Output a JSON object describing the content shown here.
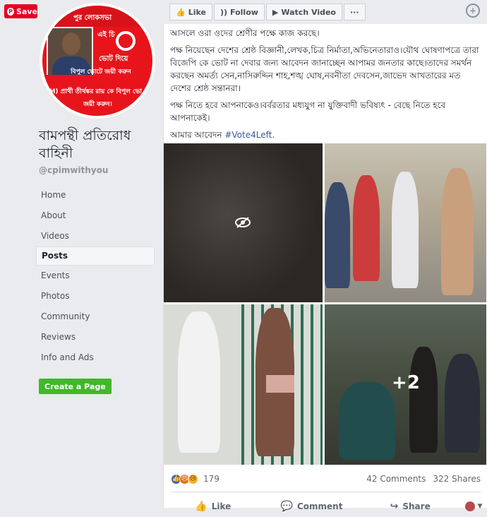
{
  "save_button": {
    "label": "Save"
  },
  "profile": {
    "name": "বামপন্থী প্রতিরোধ বাহিনী",
    "handle": "@cpimwithyou",
    "pic_text_top": "পুর লোকসভা",
    "pic_text_mid": "এই   চি",
    "pic_text_vote": "ভোট   দিয়ে",
    "pic_text_bipul": "বিপুল ভোটে জয়ী করুন",
    "pic_text_bottom1": "I(M) প্রার্থী তীর্থঙ্কর রায় কে বিপুল ভো",
    "pic_text_bottom2": "জয়ী করুন।"
  },
  "nav": {
    "items": [
      {
        "label": "Home"
      },
      {
        "label": "About"
      },
      {
        "label": "Videos"
      },
      {
        "label": "Posts"
      },
      {
        "label": "Events"
      },
      {
        "label": "Photos"
      },
      {
        "label": "Community"
      },
      {
        "label": "Reviews"
      },
      {
        "label": "Info and Ads"
      }
    ],
    "active": "Posts"
  },
  "create_page": {
    "label": "Create a Page"
  },
  "topbar": {
    "like_label": "Like",
    "follow_label": "Follow",
    "watch_label": "Watch Video",
    "more_label": "···"
  },
  "post": {
    "para1": "আসলে ওরা ওদের শ্রেণীর পক্ষে কাজ করছে।",
    "para2": "পক্ষ নিয়েছেন দেশের শ্রেষ্ঠ বিজ্ঞানী,লেখক,চিত্র নির্মাতা,অভিনেতারাও।যৌথ ঘোষণাপত্রে তারা বিজেপি কে ভোট না দেবার জন্য আবেদন জানাচ্ছেন আপামর জনতার কাছে।তাদের সমর্থন করছেন অমর্ত্য সেন,নাসিরুদ্দিন শাহ,শঙ্খ ঘোষ,নবনীতা দেবসেন,জাভেদ আখতারের মত দেশের শ্রেষ্ঠ সন্তানরা।",
    "para3": "পক্ষ নিতে হবে আপনাকেও।বর্বরতার মধ্যযুগ না যুক্তিবাদী ভবিষ্যৎ - বেছে নিতে হবে আপনাকেই।",
    "para4_prefix": "আমার আবেদন ",
    "hashtag": "#Vote4Left.",
    "more_photos": "+2"
  },
  "reactions": {
    "count": "179",
    "comments": "42 Comments",
    "shares": "322 Shares"
  },
  "actions": {
    "like": "Like",
    "comment": "Comment",
    "share": "Share"
  },
  "colors": {
    "facebook_blue": "#4267b2",
    "green_button": "#42b72a",
    "pinterest_red": "#e60023",
    "hashtag": "#365899"
  }
}
